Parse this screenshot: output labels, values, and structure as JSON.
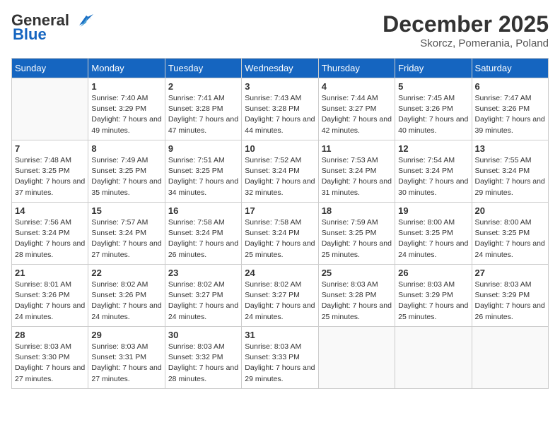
{
  "header": {
    "logo_general": "General",
    "logo_blue": "Blue",
    "month_title": "December 2025",
    "location": "Skorcz, Pomerania, Poland"
  },
  "days_of_week": [
    "Sunday",
    "Monday",
    "Tuesday",
    "Wednesday",
    "Thursday",
    "Friday",
    "Saturday"
  ],
  "weeks": [
    [
      {
        "day": "",
        "empty": true
      },
      {
        "day": "1",
        "sunrise": "7:40 AM",
        "sunset": "3:29 PM",
        "daylight": "7 hours and 49 minutes."
      },
      {
        "day": "2",
        "sunrise": "7:41 AM",
        "sunset": "3:28 PM",
        "daylight": "7 hours and 47 minutes."
      },
      {
        "day": "3",
        "sunrise": "7:43 AM",
        "sunset": "3:28 PM",
        "daylight": "7 hours and 44 minutes."
      },
      {
        "day": "4",
        "sunrise": "7:44 AM",
        "sunset": "3:27 PM",
        "daylight": "7 hours and 42 minutes."
      },
      {
        "day": "5",
        "sunrise": "7:45 AM",
        "sunset": "3:26 PM",
        "daylight": "7 hours and 40 minutes."
      },
      {
        "day": "6",
        "sunrise": "7:47 AM",
        "sunset": "3:26 PM",
        "daylight": "7 hours and 39 minutes."
      }
    ],
    [
      {
        "day": "7",
        "sunrise": "7:48 AM",
        "sunset": "3:25 PM",
        "daylight": "7 hours and 37 minutes."
      },
      {
        "day": "8",
        "sunrise": "7:49 AM",
        "sunset": "3:25 PM",
        "daylight": "7 hours and 35 minutes."
      },
      {
        "day": "9",
        "sunrise": "7:51 AM",
        "sunset": "3:25 PM",
        "daylight": "7 hours and 34 minutes."
      },
      {
        "day": "10",
        "sunrise": "7:52 AM",
        "sunset": "3:24 PM",
        "daylight": "7 hours and 32 minutes."
      },
      {
        "day": "11",
        "sunrise": "7:53 AM",
        "sunset": "3:24 PM",
        "daylight": "7 hours and 31 minutes."
      },
      {
        "day": "12",
        "sunrise": "7:54 AM",
        "sunset": "3:24 PM",
        "daylight": "7 hours and 30 minutes."
      },
      {
        "day": "13",
        "sunrise": "7:55 AM",
        "sunset": "3:24 PM",
        "daylight": "7 hours and 29 minutes."
      }
    ],
    [
      {
        "day": "14",
        "sunrise": "7:56 AM",
        "sunset": "3:24 PM",
        "daylight": "7 hours and 28 minutes."
      },
      {
        "day": "15",
        "sunrise": "7:57 AM",
        "sunset": "3:24 PM",
        "daylight": "7 hours and 27 minutes."
      },
      {
        "day": "16",
        "sunrise": "7:58 AM",
        "sunset": "3:24 PM",
        "daylight": "7 hours and 26 minutes."
      },
      {
        "day": "17",
        "sunrise": "7:58 AM",
        "sunset": "3:24 PM",
        "daylight": "7 hours and 25 minutes."
      },
      {
        "day": "18",
        "sunrise": "7:59 AM",
        "sunset": "3:25 PM",
        "daylight": "7 hours and 25 minutes."
      },
      {
        "day": "19",
        "sunrise": "8:00 AM",
        "sunset": "3:25 PM",
        "daylight": "7 hours and 24 minutes."
      },
      {
        "day": "20",
        "sunrise": "8:00 AM",
        "sunset": "3:25 PM",
        "daylight": "7 hours and 24 minutes."
      }
    ],
    [
      {
        "day": "21",
        "sunrise": "8:01 AM",
        "sunset": "3:26 PM",
        "daylight": "7 hours and 24 minutes."
      },
      {
        "day": "22",
        "sunrise": "8:02 AM",
        "sunset": "3:26 PM",
        "daylight": "7 hours and 24 minutes."
      },
      {
        "day": "23",
        "sunrise": "8:02 AM",
        "sunset": "3:27 PM",
        "daylight": "7 hours and 24 minutes."
      },
      {
        "day": "24",
        "sunrise": "8:02 AM",
        "sunset": "3:27 PM",
        "daylight": "7 hours and 24 minutes."
      },
      {
        "day": "25",
        "sunrise": "8:03 AM",
        "sunset": "3:28 PM",
        "daylight": "7 hours and 25 minutes."
      },
      {
        "day": "26",
        "sunrise": "8:03 AM",
        "sunset": "3:29 PM",
        "daylight": "7 hours and 25 minutes."
      },
      {
        "day": "27",
        "sunrise": "8:03 AM",
        "sunset": "3:29 PM",
        "daylight": "7 hours and 26 minutes."
      }
    ],
    [
      {
        "day": "28",
        "sunrise": "8:03 AM",
        "sunset": "3:30 PM",
        "daylight": "7 hours and 27 minutes."
      },
      {
        "day": "29",
        "sunrise": "8:03 AM",
        "sunset": "3:31 PM",
        "daylight": "7 hours and 27 minutes."
      },
      {
        "day": "30",
        "sunrise": "8:03 AM",
        "sunset": "3:32 PM",
        "daylight": "7 hours and 28 minutes."
      },
      {
        "day": "31",
        "sunrise": "8:03 AM",
        "sunset": "3:33 PM",
        "daylight": "7 hours and 29 minutes."
      },
      {
        "day": "",
        "empty": true
      },
      {
        "day": "",
        "empty": true
      },
      {
        "day": "",
        "empty": true
      }
    ]
  ]
}
